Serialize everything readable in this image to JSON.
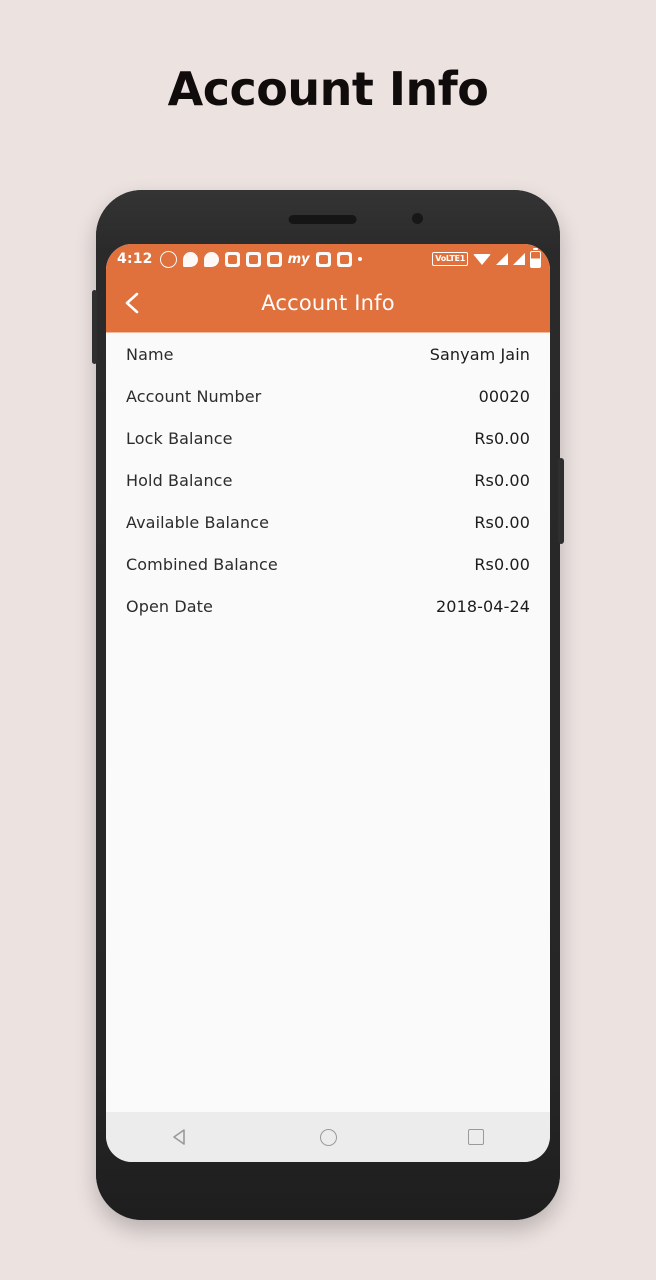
{
  "page": {
    "heading": "Account Info",
    "background_color": "#ece2e0"
  },
  "theme": {
    "accent_color": "#e0703c",
    "screen_background": "#fafafa",
    "navbar_background": "#ececec",
    "text_color": "#2c2c2c"
  },
  "status_bar": {
    "time": "4:12",
    "notification_icons": [
      "whatsapp-icon",
      "chat-icon",
      "messages-icon",
      "app-alert-icon-1",
      "app-alert-icon-2",
      "app-alert-icon-3",
      "my-app-icon",
      "camera-app-icon",
      "news-app-icon",
      "more-notifications-dot"
    ],
    "my_icon_label": "my",
    "volte_label": "VoLTE1",
    "right_icons": [
      "volte-badge",
      "wifi-icon",
      "signal-icon-1",
      "signal-icon-2",
      "battery-icon"
    ]
  },
  "app_bar": {
    "back_icon": "chevron-left-icon",
    "title": "Account Info"
  },
  "info_rows": [
    {
      "label": "Name",
      "value": "Sanyam Jain"
    },
    {
      "label": "Account Number",
      "value": "00020"
    },
    {
      "label": "Lock Balance",
      "value": "Rs0.00"
    },
    {
      "label": "Hold Balance",
      "value": "Rs0.00"
    },
    {
      "label": "Available Balance",
      "value": "Rs0.00"
    },
    {
      "label": "Combined Balance",
      "value": "Rs0.00"
    },
    {
      "label": "Open Date",
      "value": "2018-04-24"
    }
  ],
  "nav_bar": {
    "back": "back-triangle-icon",
    "home": "home-circle-icon",
    "recents": "recents-square-icon"
  }
}
